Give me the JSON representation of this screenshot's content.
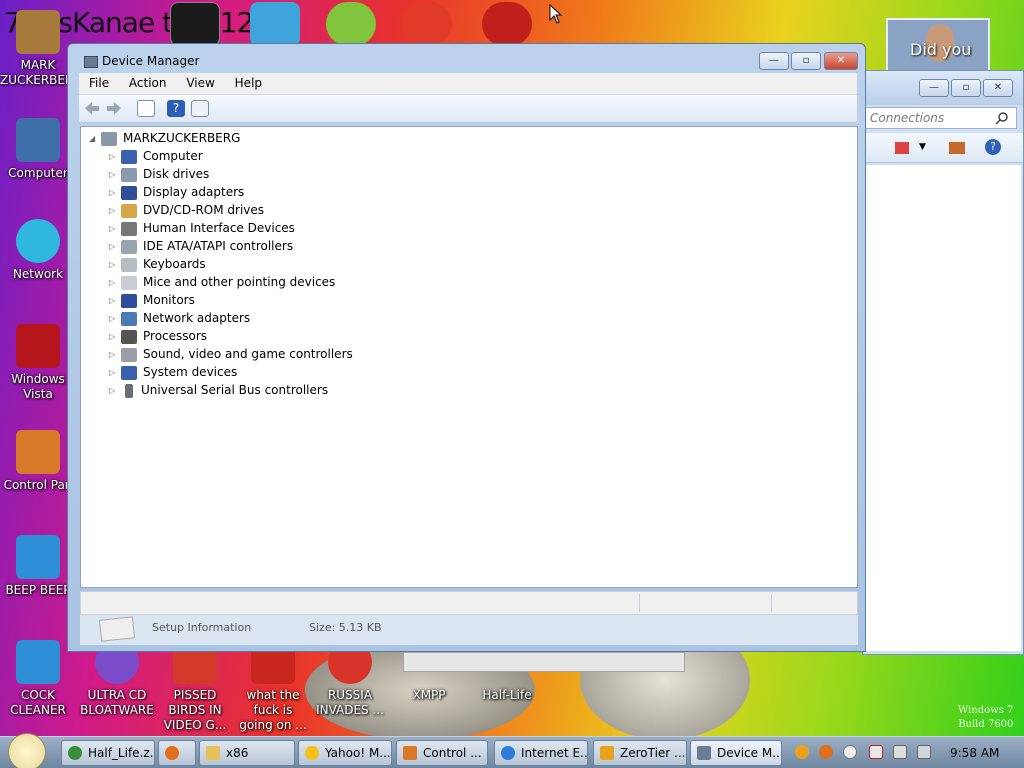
{
  "desktop": {
    "top_title": "7 ossKanae tio 012",
    "icons": [
      {
        "label": "MARK ZUCKERBERG",
        "icon": "user-folder-icon"
      },
      {
        "label": "Computer",
        "icon": "computer-icon"
      },
      {
        "label": "Network",
        "icon": "network-icon"
      },
      {
        "label": "Windows Vista",
        "icon": "recycle-bin-icon"
      },
      {
        "label": "Control Pan",
        "icon": "control-panel-icon"
      },
      {
        "label": "BEEP BEEP",
        "icon": "book-icon"
      },
      {
        "label": "COCK CLEANER",
        "icon": "book-icon"
      },
      {
        "label": "ULTRA CD BLOATWARE",
        "icon": "cd-icon"
      },
      {
        "label": "PISSED BIRDS IN VIDEO G...",
        "icon": "angry-birds-icon"
      },
      {
        "label": "what the fuck is going on ...",
        "icon": "angry-birds-icon"
      },
      {
        "label": "RUSSIA INVADES ...",
        "icon": "radiation-icon"
      },
      {
        "label": "XMPP",
        "icon": "xmpp-icon"
      },
      {
        "label": "Half-Life",
        "icon": "half-life-icon"
      }
    ],
    "avatar_text": "Did you",
    "watermark": [
      "Windows 7",
      "Build 7600"
    ]
  },
  "background_window": {
    "search_placeholder": "Connections"
  },
  "window": {
    "title": "Device Manager",
    "menu": [
      "File",
      "Action",
      "View",
      "Help"
    ],
    "tree_root": "MARKZUCKERBERG",
    "categories": [
      "Computer",
      "Disk drives",
      "Display adapters",
      "DVD/CD-ROM drives",
      "Human Interface Devices",
      "IDE ATA/ATAPI controllers",
      "Keyboards",
      "Mice and other pointing devices",
      "Monitors",
      "Network adapters",
      "Processors",
      "Sound, video and game controllers",
      "System devices",
      "Universal Serial Bus controllers"
    ],
    "below_text": "Setup Information",
    "below_size": "Size: 5.13 KB"
  },
  "taskbar": {
    "items": [
      {
        "label": "Half_Life.z...",
        "icon": "chrome-icon"
      },
      {
        "label": "",
        "icon": "firefox-icon"
      },
      {
        "label": "x86",
        "icon": "folder-icon"
      },
      {
        "label": "Yahoo! M...",
        "icon": "yahoo-icon"
      },
      {
        "label": "Control ...",
        "icon": "control-panel-icon"
      },
      {
        "label": "Internet E...",
        "icon": "ie-icon"
      },
      {
        "label": "ZeroTier ...",
        "icon": "zerotier-icon"
      },
      {
        "label": "Device M...",
        "icon": "device-manager-icon"
      }
    ],
    "clock": "9:58 AM"
  }
}
